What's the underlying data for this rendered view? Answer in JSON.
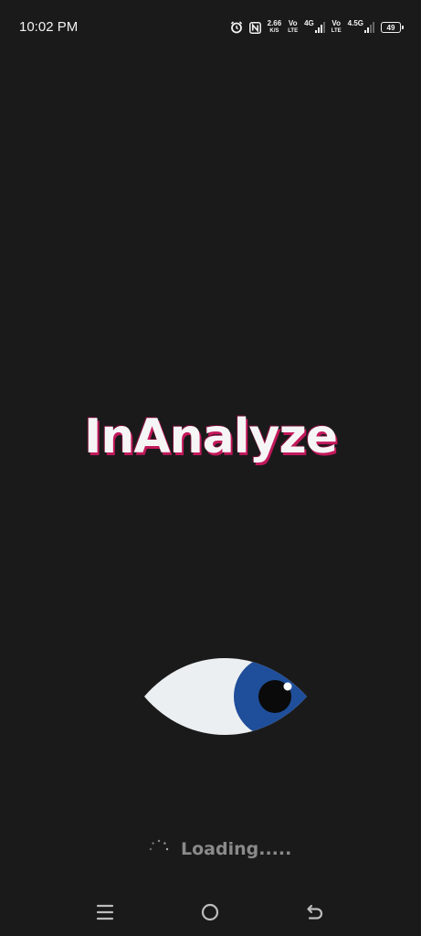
{
  "status_bar": {
    "time": "10:02 PM",
    "icons": [
      "alarm-icon",
      "nfc-icon"
    ],
    "network_speed": "2.66",
    "network_speed_unit": "K/S",
    "sim1_volte_top": "Vo",
    "sim1_volte_bottom": "LTE",
    "sim1_network": "4G",
    "sim2_volte_top": "Vo",
    "sim2_volte_bottom": "LTE",
    "sim2_network": "4.5G",
    "battery_level": "49"
  },
  "splash": {
    "app_name": "InAnalyze",
    "loading_text": "Loading.....",
    "title_color": "#f5f5f5",
    "title_shadow_color": "#c2185b",
    "eye_iris_color": "#1f4e9a",
    "background_color": "#1a1a1a"
  },
  "nav_bar": {
    "buttons": [
      "recent-apps-icon",
      "home-icon",
      "back-icon"
    ]
  }
}
